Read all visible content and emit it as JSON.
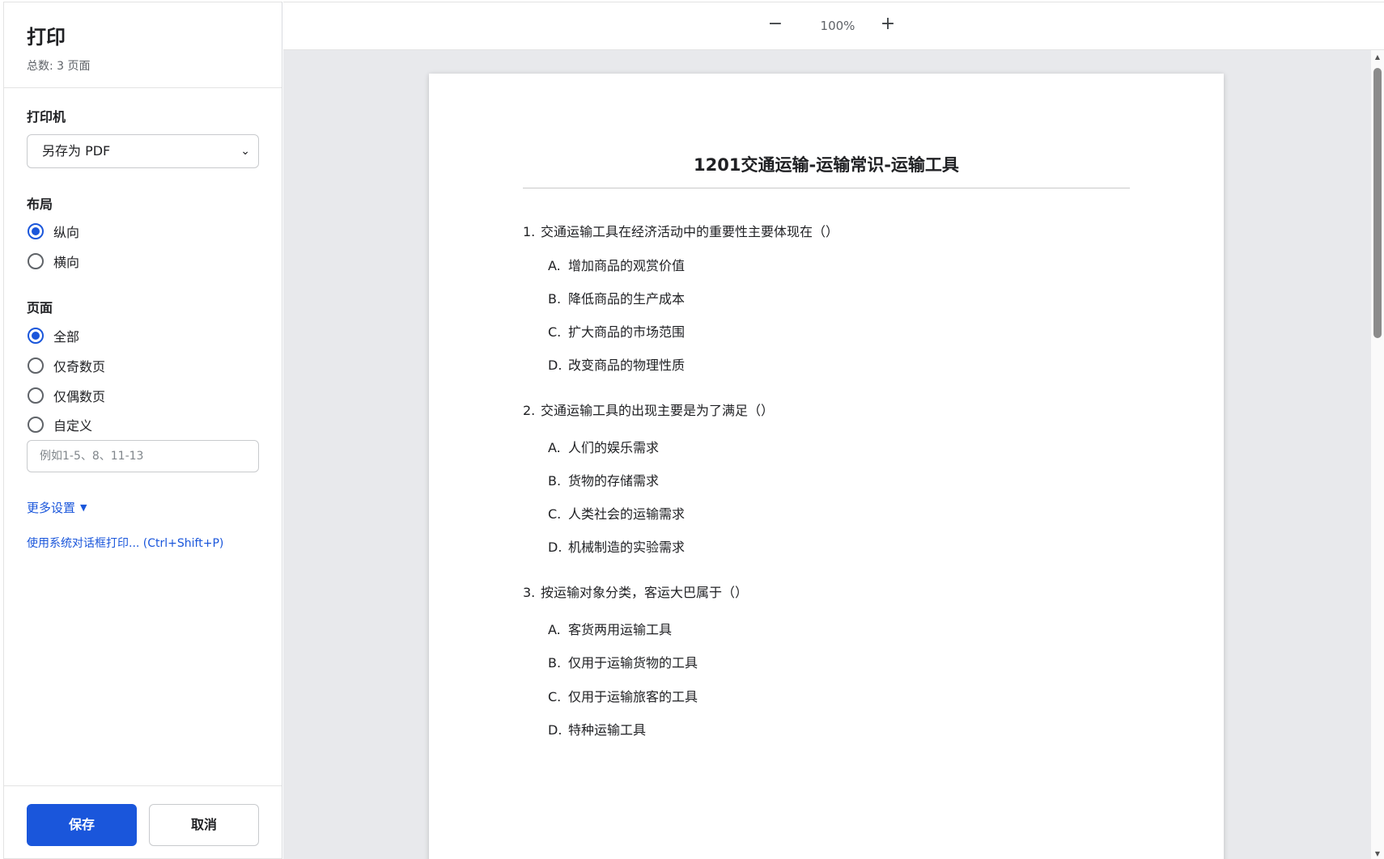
{
  "sidebar": {
    "title": "打印",
    "subtitle": "总数: 3 页面",
    "printer_label": "打印机",
    "printer_value": "另存为 PDF",
    "layout_label": "布局",
    "layout_options": [
      "纵向",
      "横向"
    ],
    "pages_label": "页面",
    "pages_options": [
      "全部",
      "仅奇数页",
      "仅偶数页",
      "自定义"
    ],
    "range_placeholder": "例如1-5、8、11-13",
    "more_settings": "更多设置",
    "system_dialog": "使用系统对话框打印... (Ctrl+Shift+P)",
    "save_label": "保存",
    "cancel_label": "取消"
  },
  "toolbar": {
    "zoom_minus": "−",
    "zoom_level": "100%",
    "zoom_plus": "+"
  },
  "document": {
    "title": "1201交通运输-运输常识-运输工具",
    "questions": [
      {
        "num": "1.",
        "text": "交通运输工具在经济活动中的重要性主要体现在（）",
        "options": [
          {
            "letter": "A.",
            "text": "增加商品的观赏价值"
          },
          {
            "letter": "B.",
            "text": "降低商品的生产成本"
          },
          {
            "letter": "C.",
            "text": "扩大商品的市场范围"
          },
          {
            "letter": "D.",
            "text": "改变商品的物理性质"
          }
        ]
      },
      {
        "num": "2.",
        "text": "交通运输工具的出现主要是为了满足（）",
        "options": [
          {
            "letter": "A.",
            "text": "人们的娱乐需求"
          },
          {
            "letter": "B.",
            "text": "货物的存储需求"
          },
          {
            "letter": "C.",
            "text": "人类社会的运输需求"
          },
          {
            "letter": "D.",
            "text": "机械制造的实验需求"
          }
        ]
      },
      {
        "num": "3.",
        "text": "按运输对象分类，客运大巴属于（）",
        "options": [
          {
            "letter": "A.",
            "text": "客货两用运输工具"
          },
          {
            "letter": "B.",
            "text": "仅用于运输货物的工具"
          },
          {
            "letter": "C.",
            "text": "仅用于运输旅客的工具"
          },
          {
            "letter": "D.",
            "text": "特种运输工具"
          }
        ]
      }
    ]
  }
}
